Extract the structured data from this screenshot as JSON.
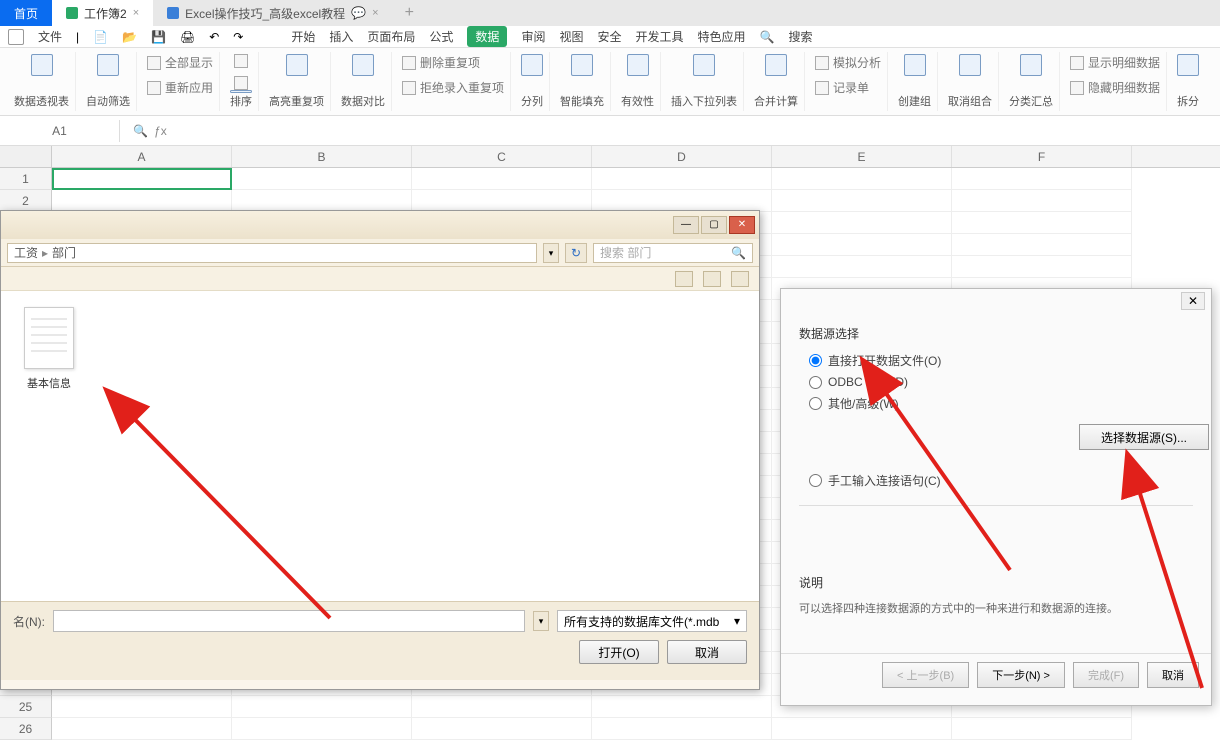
{
  "tabs": {
    "home": "首页",
    "wb": "工作簿2",
    "doc": "Excel操作技巧_高级excel教程"
  },
  "menu": {
    "file": "文件",
    "items": [
      "开始",
      "插入",
      "页面布局",
      "公式",
      "数据",
      "审阅",
      "视图",
      "安全",
      "开发工具",
      "特色应用",
      "搜索"
    ]
  },
  "ribbon": [
    {
      "label": "数据透视表"
    },
    {
      "label": "自动筛选",
      "subs": [
        "全部显示",
        "重新应用"
      ]
    },
    {
      "label": "排序",
      "subs": [
        "",
        ""
      ]
    },
    {
      "label": "高亮重复项"
    },
    {
      "label": "数据对比"
    },
    {
      "label": "",
      "subs": [
        "删除重复项",
        "拒绝录入重复项"
      ]
    },
    {
      "label": "分列"
    },
    {
      "label": "智能填充"
    },
    {
      "label": "有效性"
    },
    {
      "label": "插入下拉列表"
    },
    {
      "label": "合并计算"
    },
    {
      "label": "",
      "subs": [
        "模拟分析",
        "记录单"
      ]
    },
    {
      "label": "创建组"
    },
    {
      "label": "取消组合"
    },
    {
      "label": "分类汇总"
    },
    {
      "label": "",
      "subs": [
        "显示明细数据",
        "隐藏明细数据"
      ]
    },
    {
      "label": "拆分"
    }
  ],
  "namebox": "A1",
  "cols": [
    "A",
    "B",
    "C",
    "D",
    "E",
    "F"
  ],
  "filedlg": {
    "path": [
      "工资",
      "部门"
    ],
    "search": "搜索 部门",
    "file": "基本信息",
    "filenameLabel": "名(N):",
    "filter": "所有支持的数据库文件(*.mdb",
    "open": "打开(O)",
    "cancel": "取消"
  },
  "wiz": {
    "title": "数据源选择",
    "opt1": "直接打开数据文件(O)",
    "opt2": "ODBC DSN(D)",
    "opt3": "其他/高级(W)",
    "selbtn": "选择数据源(S)...",
    "manual": "手工输入连接语句(C)",
    "desc_t": "说明",
    "desc": "可以选择四种连接数据源的方式中的一种来进行和数据源的连接。",
    "back": "< 上一步(B)",
    "next": "下一步(N) >",
    "finish": "完成(F)",
    "cancel": "取消"
  }
}
